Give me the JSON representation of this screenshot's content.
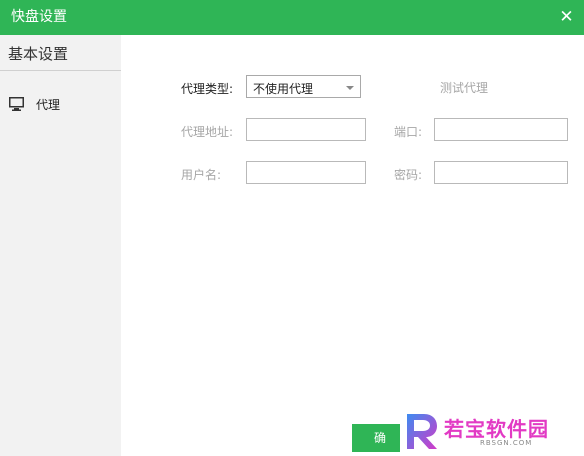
{
  "window": {
    "title": "快盘设置",
    "close_glyph": "✕"
  },
  "sidebar": {
    "header": "基本设置",
    "items": [
      {
        "label": "代理",
        "icon": "monitor-icon"
      }
    ]
  },
  "form": {
    "proxy_type_label": "代理类型:",
    "proxy_type_value": "不使用代理",
    "test_proxy_label": "测试代理",
    "address_label": "代理地址:",
    "address_value": "",
    "port_label": "端口:",
    "port_value": "",
    "username_label": "用户名:",
    "username_value": "",
    "password_label": "密码:",
    "password_value": ""
  },
  "footer": {
    "confirm_label": "确"
  },
  "watermark": {
    "text": "若宝软件园",
    "sub": "RBSGN.COM"
  },
  "colors": {
    "accent": "#2fb556",
    "sidebar_bg": "#f2f2f2",
    "watermark": "#e23ac4"
  }
}
